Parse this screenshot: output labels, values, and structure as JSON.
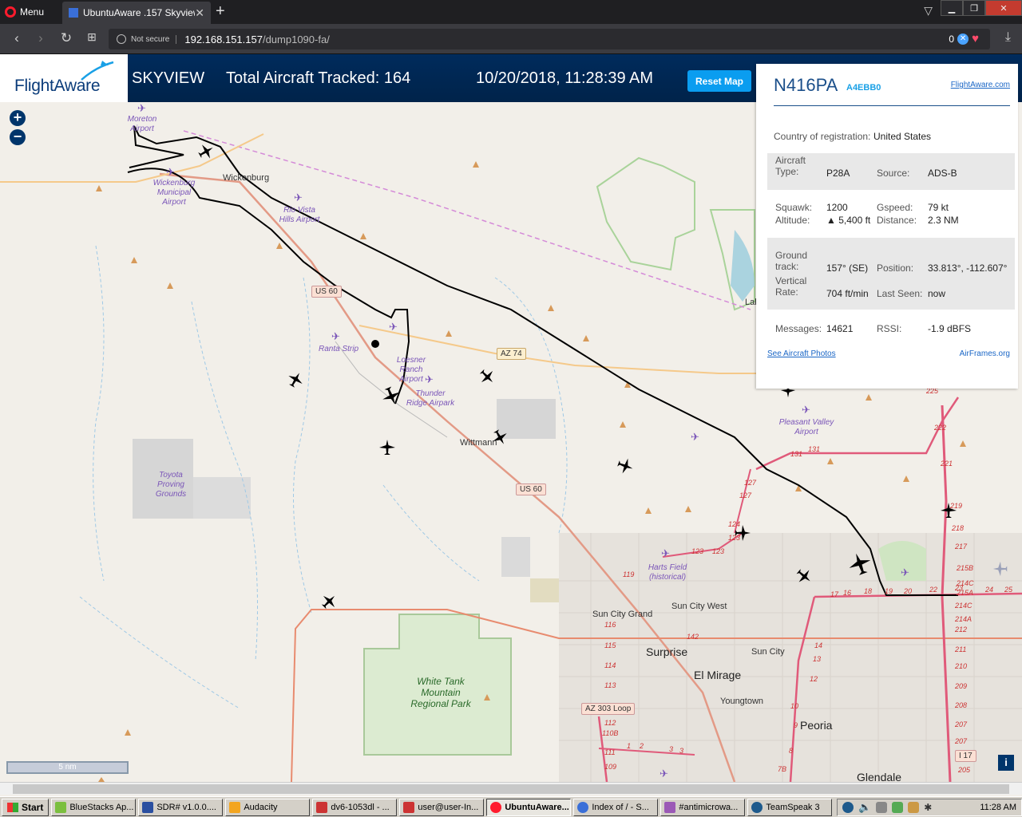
{
  "browser": {
    "menu_label": "Menu",
    "tab_title": "UbuntuAware .157 Skyview",
    "not_secure": "Not secure",
    "url_host": "192.168.151.157",
    "url_path": "/dump1090-fa/",
    "adblock_count": "0"
  },
  "header": {
    "logo": "FlightAware",
    "title": "SKYVIEW",
    "tracked_text": "Total Aircraft Tracked: 164",
    "datetime": "10/20/2018, 11:28:39 AM",
    "reset_label": "Reset Map"
  },
  "map": {
    "scale_label": "5 nm",
    "info_label": "i",
    "places": {
      "moreton": "Moreton Airport",
      "wickenburg_muni": "Wickenburg Municipal Airport",
      "rio_vista": "Rio Vista Hills Airport",
      "ranta": "Ranta Strip",
      "loesner": "Loesner Ranch Airport",
      "thunder": "Thunder Ridge Airpark",
      "toyota": "Toyota Proving Grounds",
      "pleasant": "Pleasant Valley Airport",
      "harts": "Harts Field (historical)"
    },
    "towns": {
      "wickenburg": "Wickenburg",
      "wittmann": "Wittmann",
      "sun_city_grand": "Sun City Grand",
      "sun_city_west": "Sun City West",
      "sun_city": "Sun City",
      "youngtown": "Youngtown",
      "surprise": "Surprise",
      "el_mirage": "El Mirage",
      "peoria": "Peoria",
      "glendale": "Glendale",
      "lake": "Lak"
    },
    "roads": {
      "us60_a": "US 60",
      "us60_b": "US 60",
      "az74": "AZ 74",
      "az303": "AZ 303 Loop",
      "i17": "I 17"
    },
    "park": "White Tank Mountain Regional Park",
    "exits": [
      "225",
      "222",
      "221",
      "219",
      "218",
      "217",
      "215B",
      "214C",
      "215A",
      "214C",
      "214A",
      "212",
      "211",
      "210",
      "209",
      "208",
      "207",
      "207",
      "205",
      "131",
      "131",
      "127",
      "127",
      "124",
      "123",
      "123",
      "123",
      "119",
      "116",
      "115",
      "114",
      "113",
      "112",
      "110B",
      "111",
      "109",
      "142",
      "17",
      "16",
      "18",
      "19",
      "20",
      "22",
      "23",
      "24",
      "25",
      "14",
      "13",
      "12",
      "10",
      "9",
      "8",
      "7B",
      "1",
      "2",
      "3",
      "3"
    ]
  },
  "panel": {
    "ident": "N416PA",
    "hex": "A4EBB0",
    "fa_link": "FlightAware.com",
    "country_label": "Country of registration:",
    "country": "United States",
    "type_label": "Aircraft Type:",
    "type": "P28A",
    "source_label": "Source:",
    "source": "ADS-B",
    "squawk_label": "Squawk:",
    "squawk": "1200",
    "gspeed_label": "Gspeed:",
    "gspeed": "79 kt",
    "altitude_label": "Altitude:",
    "altitude": "▲ 5,400 ft",
    "distance_label": "Distance:",
    "distance": "2.3 NM",
    "track_label": "Ground track:",
    "track": "157° (SE)",
    "position_label": "Position:",
    "position": "33.813°, -112.607°",
    "vrate_label": "Vertical Rate:",
    "vrate": "704 ft/min",
    "lastseen_label": "Last Seen:",
    "lastseen": "now",
    "messages_label": "Messages:",
    "messages": "14621",
    "rssi_label": "RSSI:",
    "rssi": "-1.9 dBFS",
    "photos_link": "See Aircraft Photos",
    "airframes_link": "AirFrames.org"
  },
  "taskbar": {
    "start": "Start",
    "items": [
      "BlueStacks Ap...",
      "SDR# v1.0.0....",
      "Audacity",
      "dv6-1053dl - ...",
      "user@user-In...",
      "UbuntuAware...",
      "Index of / - S...",
      "#antimicrowa...",
      "TeamSpeak 3"
    ],
    "clock": "11:28 AM"
  }
}
